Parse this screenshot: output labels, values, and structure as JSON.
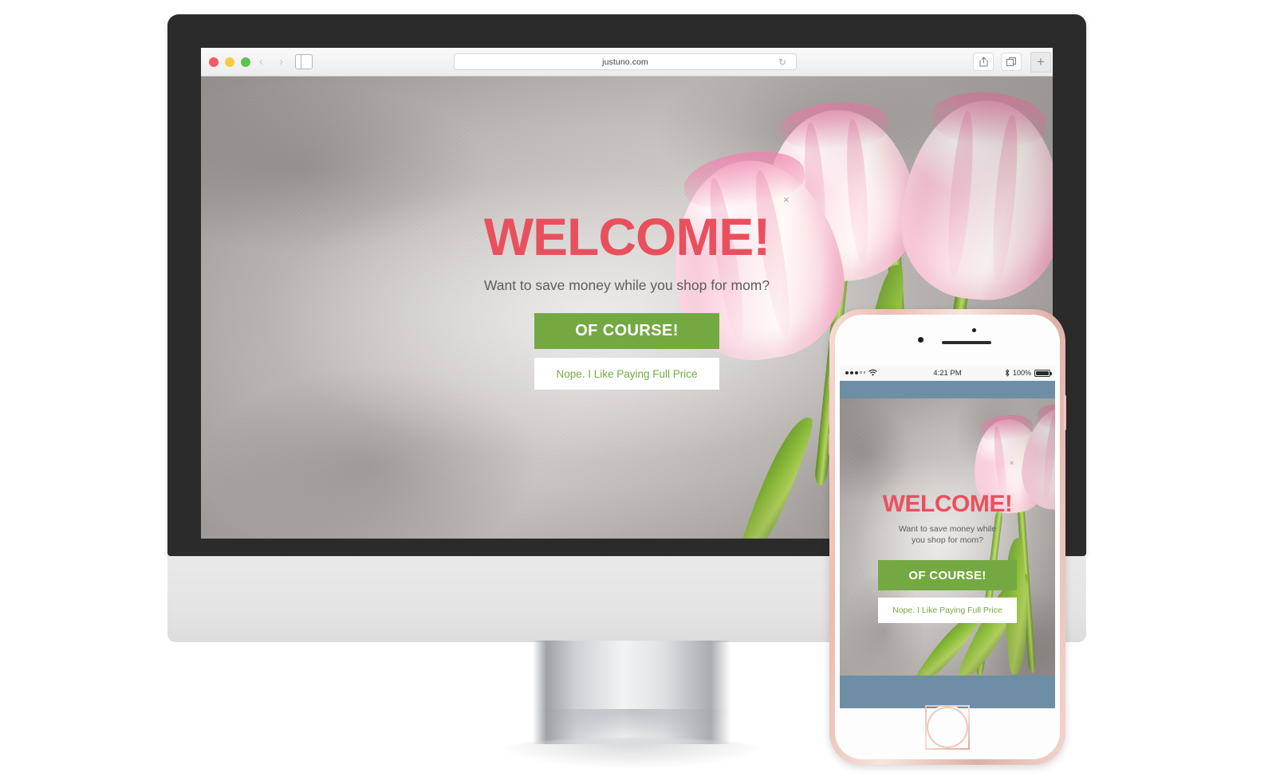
{
  "browser": {
    "url": "justuno.com",
    "traffic_lights": [
      "close-red",
      "minimize-yellow",
      "maximize-green"
    ],
    "back_label": "‹",
    "forward_label": "›",
    "reload_icon": "reload-icon",
    "sidebar_icon": "sidebar-toggle-icon",
    "share_icon": "share-icon",
    "tabs_icon": "show-tabs-icon",
    "newtab_label": "+"
  },
  "popup": {
    "heading": "WELCOME!",
    "subheading": "Want to save money while you shop for mom?",
    "primary_cta": "OF COURSE!",
    "secondary_cta": "Nope. I Like Paying Full Price",
    "close_label": "×",
    "accent_pink": "#e9505e",
    "accent_green": "#74a942",
    "secondary_bg": "#ffffff"
  },
  "popup_mobile": {
    "heading": "WELCOME!",
    "subheading_line1": "Want to save money while",
    "subheading_line2": "you shop for mom?",
    "primary_cta": "OF COURSE!",
    "secondary_cta": "Nope. I Like Paying Full Price",
    "close_label": "×"
  },
  "phone": {
    "status_time": "4:21 PM",
    "battery_percent": "100%",
    "bluetooth_icon": "bluetooth-icon",
    "wifi_icon": "wifi-icon",
    "signal_icon": "cellular-signal-icon",
    "navbar_color": "#6d8ea5",
    "body_color": "#f0c8bd"
  },
  "scene": {
    "monitor_bezel_color": "#2b2b2b",
    "monitor_chin_color": "#e7e7e7",
    "background_color": "#ffffff"
  }
}
